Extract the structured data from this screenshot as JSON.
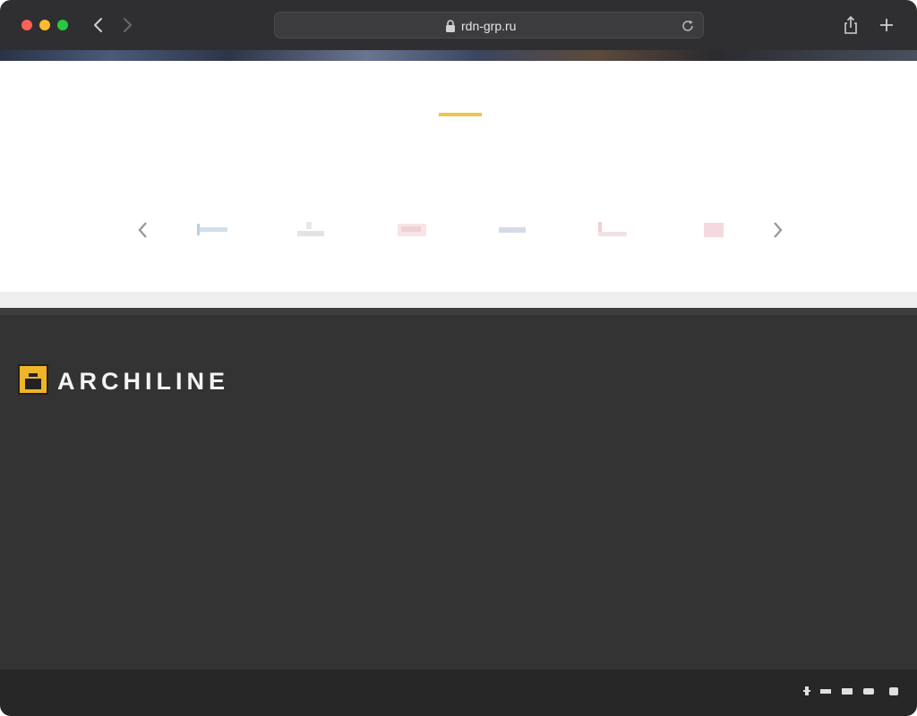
{
  "browser": {
    "url": "rdn-grp.ru",
    "traffic_lights": [
      "close",
      "minimize",
      "zoom"
    ],
    "icons": {
      "back": "chevron-left-icon",
      "forward": "chevron-right-icon",
      "lock": "lock-icon",
      "reload": "reload-icon",
      "share": "share-icon",
      "new_tab": "plus-icon"
    }
  },
  "clients_section": {
    "title": "",
    "accent_color": "#f0c44a",
    "logo_colors": [
      "#cfe0ee",
      "#e3e3e3",
      "#f2cfd2",
      "#d6dae8",
      "#f0d0d3",
      "#f5d9dc"
    ],
    "prev_icon": "chevron-left-icon",
    "next_icon": "chevron-right-icon"
  },
  "footer": {
    "logo_text": "ARCHILINE",
    "about_text": "",
    "navigation": {
      "heading": "",
      "items": [
        "",
        "",
        "",
        "",
        ""
      ]
    },
    "latest_offers": {
      "heading": "",
      "offers": [
        {
          "label": "",
          "value": ""
        },
        {
          "label": "",
          "value": ""
        },
        {
          "label": "",
          "value": ""
        }
      ]
    },
    "contacts": {
      "heading": "",
      "address": "",
      "phone": "",
      "email_label": "",
      "email": "",
      "hours": ""
    },
    "copyright": "",
    "social_icons": [
      "facebook-icon",
      "vk-icon",
      "twitter-icon",
      "youtube-icon",
      "instagram-icon"
    ],
    "accent_color": "#d9a534"
  }
}
